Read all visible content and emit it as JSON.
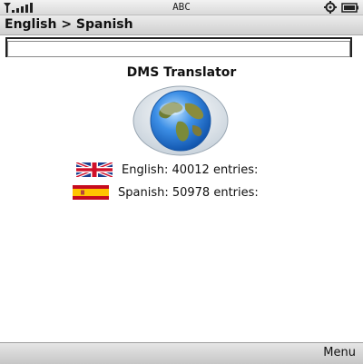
{
  "status_bar": {
    "input_mode": "ABC",
    "signal_icon": "signal-strength-icon",
    "right_icons": [
      "settings-icon",
      "battery-icon"
    ]
  },
  "header": {
    "title": "English > Spanish"
  },
  "search": {
    "value": "",
    "placeholder": ""
  },
  "main": {
    "app_name": "DMS Translator",
    "logo_icon": "globe-icon",
    "dictionaries": [
      {
        "text": "English: 40012 entries:",
        "flag_icon": "uk-flag-icon"
      },
      {
        "text": "Spanish: 50978 entries:",
        "flag_icon": "spain-flag-icon"
      }
    ]
  },
  "softkeys": {
    "right_label": "Menu"
  },
  "colors": {
    "bar_gradient_top": "#ececec",
    "bar_gradient_bottom": "#cfcfcf",
    "globe_ocean": "#1f6fd1",
    "globe_land": "#7a8a3a"
  }
}
